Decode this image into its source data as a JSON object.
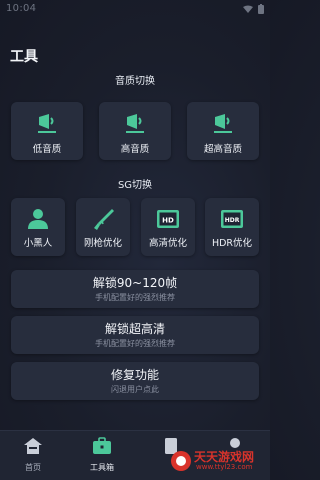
{
  "status_bar": {
    "time": "10:04"
  },
  "page_title": "工具",
  "sound_section": {
    "title": "音质切换",
    "items": [
      {
        "label": "低音质",
        "icon": "speaker-low-icon"
      },
      {
        "label": "高音质",
        "icon": "speaker-high-icon"
      },
      {
        "label": "超高音质",
        "icon": "speaker-ultra-icon"
      }
    ]
  },
  "sg_section": {
    "title": "SG切换",
    "items": [
      {
        "label": "小黑人",
        "icon": "person-icon"
      },
      {
        "label": "刚枪优化",
        "icon": "gun-icon"
      },
      {
        "label": "高清优化",
        "icon": "hd-icon",
        "badge": "HD"
      },
      {
        "label": "HDR优化",
        "icon": "hdr-icon",
        "badge": "HDR"
      }
    ]
  },
  "banners": [
    {
      "title": "解锁90~120帧",
      "subtitle": "手机配置好的强烈推荐"
    },
    {
      "title": "解锁超高清",
      "subtitle": "手机配置好的强烈推荐"
    },
    {
      "title": "修复功能",
      "subtitle": "闪退用户点此"
    }
  ],
  "nav": {
    "items": [
      {
        "label": "首页",
        "icon": "home-icon"
      },
      {
        "label": "工具箱",
        "icon": "toolbox-icon",
        "active": true
      }
    ]
  },
  "watermark": {
    "text": "天天游戏网",
    "url": "www.ttyl23.com"
  },
  "colors": {
    "accent": "#4cc89a",
    "card": "#272d3d",
    "background": "#1a1e2b"
  }
}
